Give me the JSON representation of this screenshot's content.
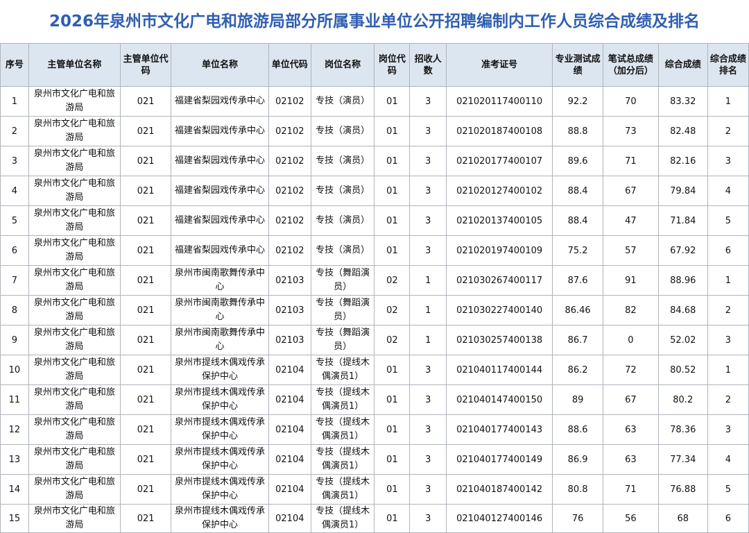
{
  "title": "2026年泉州市文化广电和旅游局部分所属事业单位公开招聘编制内工作人员综合成绩及排名",
  "columns": [
    "序号",
    "主管单位名称",
    "主管单位代码",
    "单位名称",
    "单位代码",
    "岗位名称",
    "岗位代码",
    "招收人数",
    "准考证号",
    "专业测试成绩",
    "笔试总成绩（加分后）",
    "综合成绩",
    "综合成绩排名"
  ],
  "rows": [
    [
      "1",
      "泉州市文化广电和旅游局",
      "021",
      "福建省梨园戏传承中心",
      "02102",
      "专技（演员）",
      "01",
      "3",
      "021020117400110",
      "92.2",
      "70",
      "83.32",
      "1"
    ],
    [
      "2",
      "泉州市文化广电和旅游局",
      "021",
      "福建省梨园戏传承中心",
      "02102",
      "专技（演员）",
      "01",
      "3",
      "021020187400108",
      "88.8",
      "73",
      "82.48",
      "2"
    ],
    [
      "3",
      "泉州市文化广电和旅游局",
      "021",
      "福建省梨园戏传承中心",
      "02102",
      "专技（演员）",
      "01",
      "3",
      "021020177400107",
      "89.6",
      "71",
      "82.16",
      "3"
    ],
    [
      "4",
      "泉州市文化广电和旅游局",
      "021",
      "福建省梨园戏传承中心",
      "02102",
      "专技（演员）",
      "01",
      "3",
      "021020127400102",
      "88.4",
      "67",
      "79.84",
      "4"
    ],
    [
      "5",
      "泉州市文化广电和旅游局",
      "021",
      "福建省梨园戏传承中心",
      "02102",
      "专技（演员）",
      "01",
      "3",
      "021020137400105",
      "88.4",
      "47",
      "71.84",
      "5"
    ],
    [
      "6",
      "泉州市文化广电和旅游局",
      "021",
      "福建省梨园戏传承中心",
      "02102",
      "专技（演员）",
      "01",
      "3",
      "021020197400109",
      "75.2",
      "57",
      "67.92",
      "6"
    ],
    [
      "7",
      "泉州市文化广电和旅游局",
      "021",
      "泉州市闽南歌舞传承中心",
      "02103",
      "专技（舞蹈演员）",
      "02",
      "1",
      "021030267400117",
      "87.6",
      "91",
      "88.96",
      "1"
    ],
    [
      "8",
      "泉州市文化广电和旅游局",
      "021",
      "泉州市闽南歌舞传承中心",
      "02103",
      "专技（舞蹈演员）",
      "02",
      "1",
      "021030227400140",
      "86.46",
      "82",
      "84.68",
      "2"
    ],
    [
      "9",
      "泉州市文化广电和旅游局",
      "021",
      "泉州市闽南歌舞传承中心",
      "02103",
      "专技（舞蹈演员）",
      "02",
      "1",
      "021030257400138",
      "86.7",
      "0",
      "52.02",
      "3"
    ],
    [
      "10",
      "泉州市文化广电和旅游局",
      "021",
      "泉州市提线木偶戏传承保护中心",
      "02104",
      "专技（提线木偶演员1）",
      "01",
      "3",
      "021040117400144",
      "86.2",
      "72",
      "80.52",
      "1"
    ],
    [
      "11",
      "泉州市文化广电和旅游局",
      "021",
      "泉州市提线木偶戏传承保护中心",
      "02104",
      "专技（提线木偶演员1）",
      "01",
      "3",
      "021040147400150",
      "89",
      "67",
      "80.2",
      "2"
    ],
    [
      "12",
      "泉州市文化广电和旅游局",
      "021",
      "泉州市提线木偶戏传承保护中心",
      "02104",
      "专技（提线木偶演员1）",
      "01",
      "3",
      "021040177400143",
      "88.6",
      "63",
      "78.36",
      "3"
    ],
    [
      "13",
      "泉州市文化广电和旅游局",
      "021",
      "泉州市提线木偶戏传承保护中心",
      "02104",
      "专技（提线木偶演员1）",
      "01",
      "3",
      "021040177400149",
      "86.9",
      "63",
      "77.34",
      "4"
    ],
    [
      "14",
      "泉州市文化广电和旅游局",
      "021",
      "泉州市提线木偶戏传承保护中心",
      "02104",
      "专技（提线木偶演员1）",
      "01",
      "3",
      "021040187400142",
      "80.8",
      "71",
      "76.88",
      "5"
    ],
    [
      "15",
      "泉州市文化广电和旅游局",
      "021",
      "泉州市提线木偶戏传承保护中心",
      "02104",
      "专技（提线木偶演员1）",
      "01",
      "3",
      "021040127400146",
      "76",
      "56",
      "68",
      "6"
    ]
  ]
}
